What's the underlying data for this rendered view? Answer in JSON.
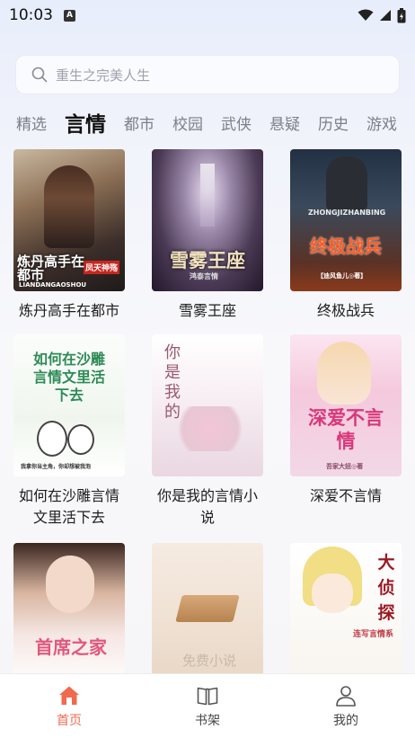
{
  "status_bar": {
    "time": "10:03",
    "notif_icon": "A",
    "icons": [
      "wifi-icon",
      "signal-icon",
      "battery-icon"
    ]
  },
  "search": {
    "placeholder": "重生之完美人生"
  },
  "tabs": [
    {
      "label": "精选",
      "active": false
    },
    {
      "label": "言情",
      "active": true
    },
    {
      "label": "都市",
      "active": false
    },
    {
      "label": "校园",
      "active": false
    },
    {
      "label": "武侠",
      "active": false
    },
    {
      "label": "悬疑",
      "active": false
    },
    {
      "label": "历史",
      "active": false
    },
    {
      "label": "游戏",
      "active": false
    }
  ],
  "books": [
    {
      "title": "炼丹高手在都市",
      "cover_text": "炼丹高手在都市",
      "cover_sub": "LIANDANGAOSHOU",
      "cover_badge": "凤天神殇"
    },
    {
      "title": "雪雾王座",
      "cover_text": "雪雾王座",
      "cover_sub": "鸿泰言情"
    },
    {
      "title": "终极战兵",
      "cover_text": "终极战兵",
      "cover_sub": "ZHONGJIZHANBING",
      "cover_author": "【迪风鱼儿◎著】"
    },
    {
      "title": "如何在沙雕言情文里活下去",
      "cover_text": "如何在沙雕言情文里活下去",
      "cover_sub": "我拿你当主角，你却想被我泡"
    },
    {
      "title": "你是我的言情小说",
      "cover_text": "你是我的"
    },
    {
      "title": "深爱不言情",
      "cover_text": "深爱不言情",
      "cover_author": "吾家大妞◎著"
    },
    {
      "title": "",
      "cover_text": "首席之家"
    },
    {
      "title": "",
      "cover_text": "免费小说"
    },
    {
      "title": "",
      "cover_text": "大侦探",
      "cover_sub": "连写言情系"
    }
  ],
  "bottom_nav": [
    {
      "label": "首页",
      "icon": "home-icon",
      "active": true
    },
    {
      "label": "书架",
      "icon": "book-icon",
      "active": false
    },
    {
      "label": "我的",
      "icon": "person-icon",
      "active": false
    }
  ],
  "colors": {
    "accent": "#f06a4f",
    "tab_inactive": "#7b7f89"
  }
}
